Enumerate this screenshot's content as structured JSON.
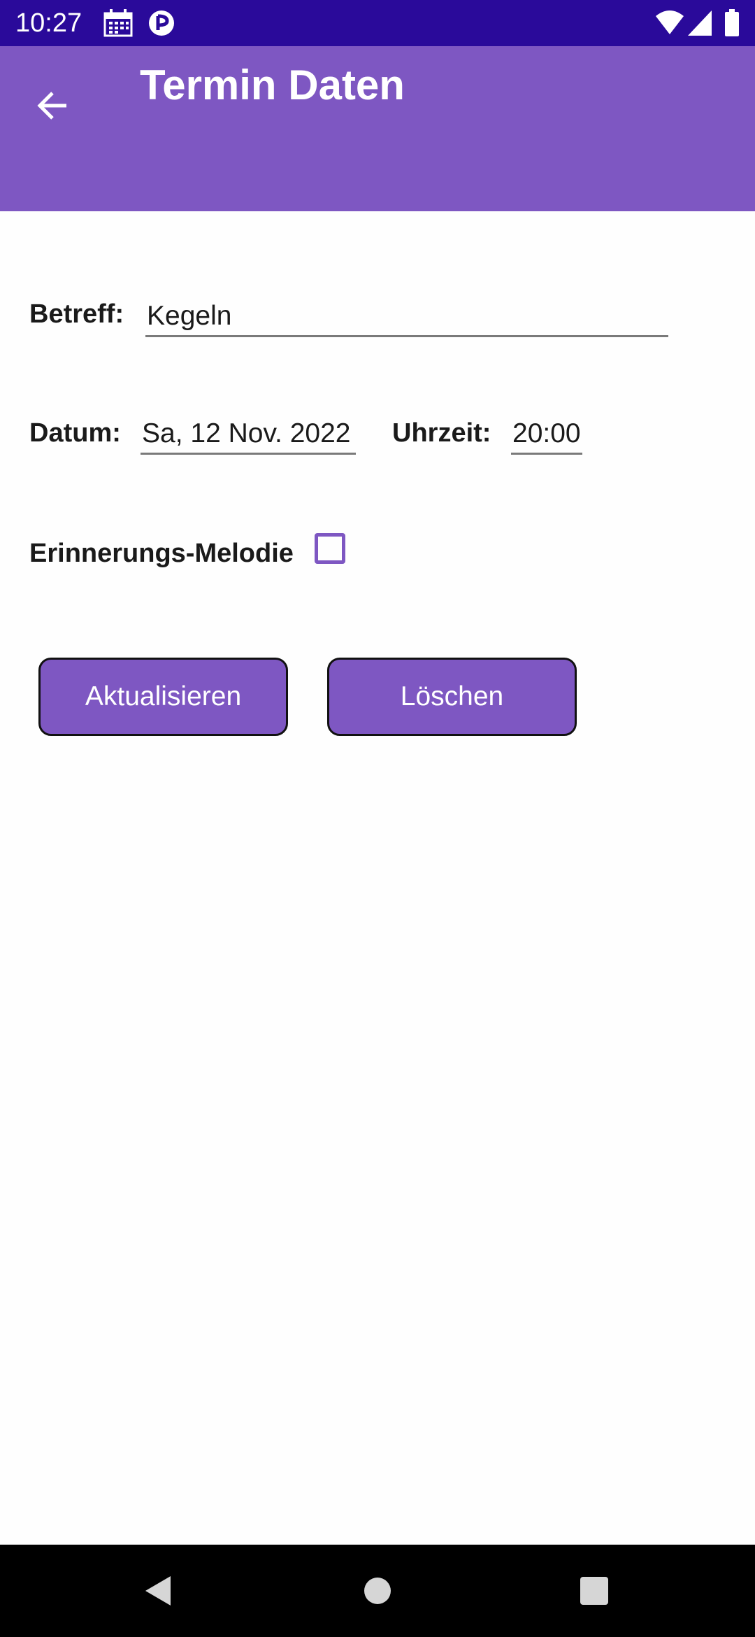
{
  "status_bar": {
    "time": "10:27",
    "icons": [
      "calendar-icon",
      "app-notification-icon",
      "wifi-icon",
      "signal-icon",
      "battery-icon"
    ],
    "background": "#2a0a9a"
  },
  "app_bar": {
    "title": "Termin Daten",
    "back_icon": "arrow-back-icon",
    "background": "#7e57c2"
  },
  "form": {
    "subject": {
      "label": "Betreff:",
      "value": "Kegeln"
    },
    "date": {
      "label": "Datum:",
      "value": "Sa, 12 Nov. 2022"
    },
    "time": {
      "label": "Uhrzeit:",
      "value": "20:00"
    },
    "reminder": {
      "label": "Erinnerungs-Melodie",
      "checked": false
    }
  },
  "actions": {
    "update_label": "Aktualisieren",
    "delete_label": "Löschen"
  },
  "nav_bar": {
    "icons": [
      "nav-back-icon",
      "nav-home-icon",
      "nav-recents-icon"
    ]
  },
  "colors": {
    "accent": "#7e57c2",
    "status_bar": "#2a0a9a",
    "nav_bar": "#000000"
  }
}
